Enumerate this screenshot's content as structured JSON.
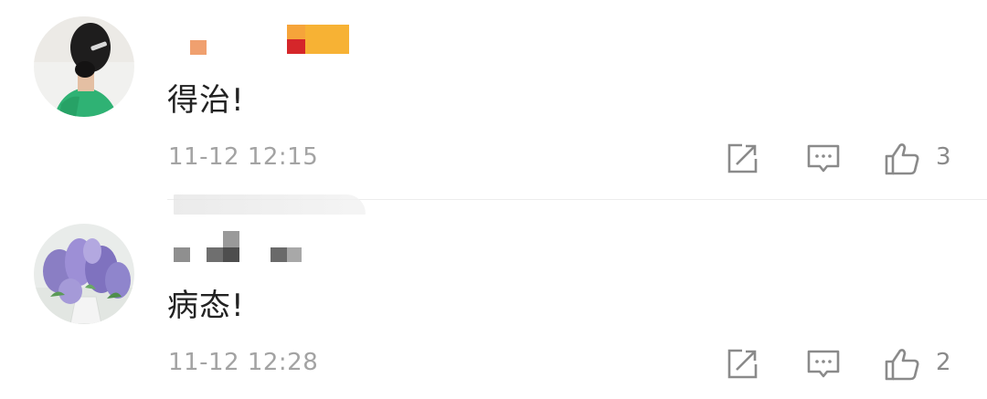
{
  "comments": [
    {
      "username_display": "",
      "text": "得治!",
      "timestamp": "11-12 12:15",
      "likes": "3",
      "avatar_icon": "girl-hair-bun-avatar"
    },
    {
      "username_display": "",
      "text": "病态!",
      "timestamp": "11-12 12:28",
      "likes": "2",
      "avatar_icon": "lilac-flowers-avatar"
    }
  ],
  "colors": {
    "text": "#222222",
    "timestamp": "#a3a3a3",
    "icon": "#8a8a8a",
    "divider": "#ececec"
  }
}
